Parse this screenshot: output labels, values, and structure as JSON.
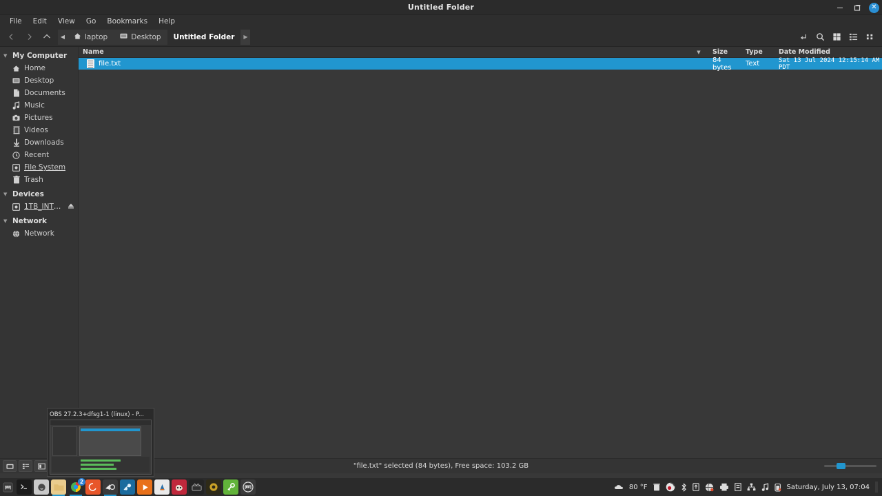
{
  "window": {
    "title": "Untitled Folder",
    "controls": {
      "minimize": "–",
      "maximize": "❐",
      "close": "✕"
    }
  },
  "menubar": {
    "items": [
      {
        "label": "File"
      },
      {
        "label": "Edit"
      },
      {
        "label": "View"
      },
      {
        "label": "Go"
      },
      {
        "label": "Bookmarks"
      },
      {
        "label": "Help"
      }
    ]
  },
  "toolbar": {
    "back": "‹",
    "forward": "›",
    "up": "∧",
    "crumb_left": "◀",
    "crumb_right": "▶",
    "breadcrumbs": [
      {
        "label": "laptop",
        "icon": "home-icon",
        "active": false
      },
      {
        "label": "Desktop",
        "icon": "folder-icon",
        "active": false
      },
      {
        "label": "Untitled Folder",
        "icon": "none",
        "active": true
      }
    ],
    "right_icons": [
      {
        "name": "path-entry-icon"
      },
      {
        "name": "search-icon"
      },
      {
        "name": "icon-view-icon"
      },
      {
        "name": "list-view-icon"
      },
      {
        "name": "compact-view-icon"
      }
    ]
  },
  "sidebar": {
    "groups": [
      {
        "label": "My Computer",
        "expander": "▼",
        "items": [
          {
            "label": "Home",
            "icon": "home-icon",
            "underline": false
          },
          {
            "label": "Desktop",
            "icon": "desktop-icon",
            "underline": false
          },
          {
            "label": "Documents",
            "icon": "document-icon",
            "underline": false
          },
          {
            "label": "Music",
            "icon": "music-note-icon",
            "underline": false
          },
          {
            "label": "Pictures",
            "icon": "camera-icon",
            "underline": false
          },
          {
            "label": "Videos",
            "icon": "film-icon",
            "underline": false
          },
          {
            "label": "Downloads",
            "icon": "download-arrow-icon",
            "underline": false
          },
          {
            "label": "Recent",
            "icon": "clock-icon",
            "underline": false
          },
          {
            "label": "File System",
            "icon": "drive-icon",
            "underline": true
          },
          {
            "label": "Trash",
            "icon": "trash-icon",
            "underline": false
          }
        ]
      },
      {
        "label": "Devices",
        "expander": "▼",
        "items": [
          {
            "label": "1TB_INTER…",
            "icon": "drive-icon",
            "underline": true,
            "eject": "⏏"
          }
        ]
      },
      {
        "label": "Network",
        "expander": "▼",
        "items": [
          {
            "label": "Network",
            "icon": "globe-icon",
            "underline": false
          }
        ]
      }
    ]
  },
  "filelist": {
    "columns": {
      "name": "Name",
      "sort_indicator": "▼",
      "size": "Size",
      "type": "Type",
      "date": "Date Modified"
    },
    "rows": [
      {
        "name": "file.txt",
        "icon": "text-file-icon",
        "size": "84 bytes",
        "type": "Text",
        "date": "Sat 13 Jul 2024 12:15:14 AM PDT",
        "selected": true
      }
    ]
  },
  "statusbar": {
    "text": "\"file.txt\" selected (84 bytes), Free space: 103.2 GB",
    "view_buttons": [
      {
        "name": "icon-view-button",
        "glyph": "▣"
      },
      {
        "name": "list-view-button",
        "glyph": "☰"
      },
      {
        "name": "compact-view-button",
        "glyph": "▤"
      }
    ]
  },
  "preview": {
    "title": "OBS 27.2.3+dfsg1-1 (linux) - P..."
  },
  "taskbar": {
    "menu_icon": "mint-menu-icon",
    "launchers": [
      {
        "name": "terminal-icon",
        "glyph": "⬛",
        "color": "#1c1c1c",
        "active": false,
        "badge": ""
      },
      {
        "name": "messaging-icon",
        "glyph": "●",
        "color": "#c8c8c8",
        "active": false,
        "badge": ""
      },
      {
        "name": "file-manager-icon",
        "glyph": "▬",
        "color": "#e8c88a",
        "active": true,
        "badge": ""
      },
      {
        "name": "chrome-icon",
        "glyph": "◉",
        "color": "#4a90d9",
        "active": true,
        "badge": "2"
      },
      {
        "name": "firefox-icon",
        "glyph": "↻",
        "color": "#e8562a",
        "active": false,
        "badge": ""
      },
      {
        "name": "obs-icon",
        "glyph": "◑",
        "color": "#3a3a3a",
        "active": true,
        "badge": ""
      },
      {
        "name": "steam-icon",
        "glyph": "➳",
        "color": "#1b6b9e",
        "active": false,
        "badge": ""
      },
      {
        "name": "media-player-icon",
        "glyph": "▶",
        "color": "#e8701a",
        "active": false,
        "badge": ""
      },
      {
        "name": "vlc-icon",
        "glyph": "▲",
        "color": "#e9e9e9",
        "active": false,
        "badge": ""
      },
      {
        "name": "gimp-icon",
        "glyph": "●",
        "color": "#c0283c",
        "active": false,
        "badge": ""
      },
      {
        "name": "video-editor-icon",
        "glyph": "▰",
        "color": "#2a2a2a",
        "active": false,
        "badge": ""
      },
      {
        "name": "settings-icon",
        "glyph": "⚙",
        "color": "#c9a227",
        "active": false,
        "badge": ""
      },
      {
        "name": "key-tool-icon",
        "glyph": "✡",
        "color": "#62b33a",
        "active": false,
        "badge": ""
      },
      {
        "name": "linux-mint-icon",
        "glyph": "Ⓜ",
        "color": "#3a3a3a",
        "active": false,
        "badge": ""
      }
    ],
    "tray": {
      "weather": "80 °F",
      "icons": [
        {
          "name": "cloud-icon",
          "glyph": "☁"
        },
        {
          "name": "trash-icon",
          "glyph": "Ὕ1"
        },
        {
          "name": "obs-tray-icon",
          "glyph": "◔"
        },
        {
          "name": "bluetooth-icon",
          "glyph": "ᛦ"
        },
        {
          "name": "update-manager-icon",
          "glyph": "⬆"
        },
        {
          "name": "network-icon",
          "glyph": "◕"
        },
        {
          "name": "printer-icon",
          "glyph": "⎙"
        },
        {
          "name": "clipboard-icon",
          "glyph": "▤"
        },
        {
          "name": "sharing-icon",
          "glyph": "⛓"
        },
        {
          "name": "sound-icon",
          "glyph": "♫"
        },
        {
          "name": "battery-icon",
          "glyph": "▯"
        }
      ],
      "clock": "Saturday, July 13, 07:04"
    }
  }
}
